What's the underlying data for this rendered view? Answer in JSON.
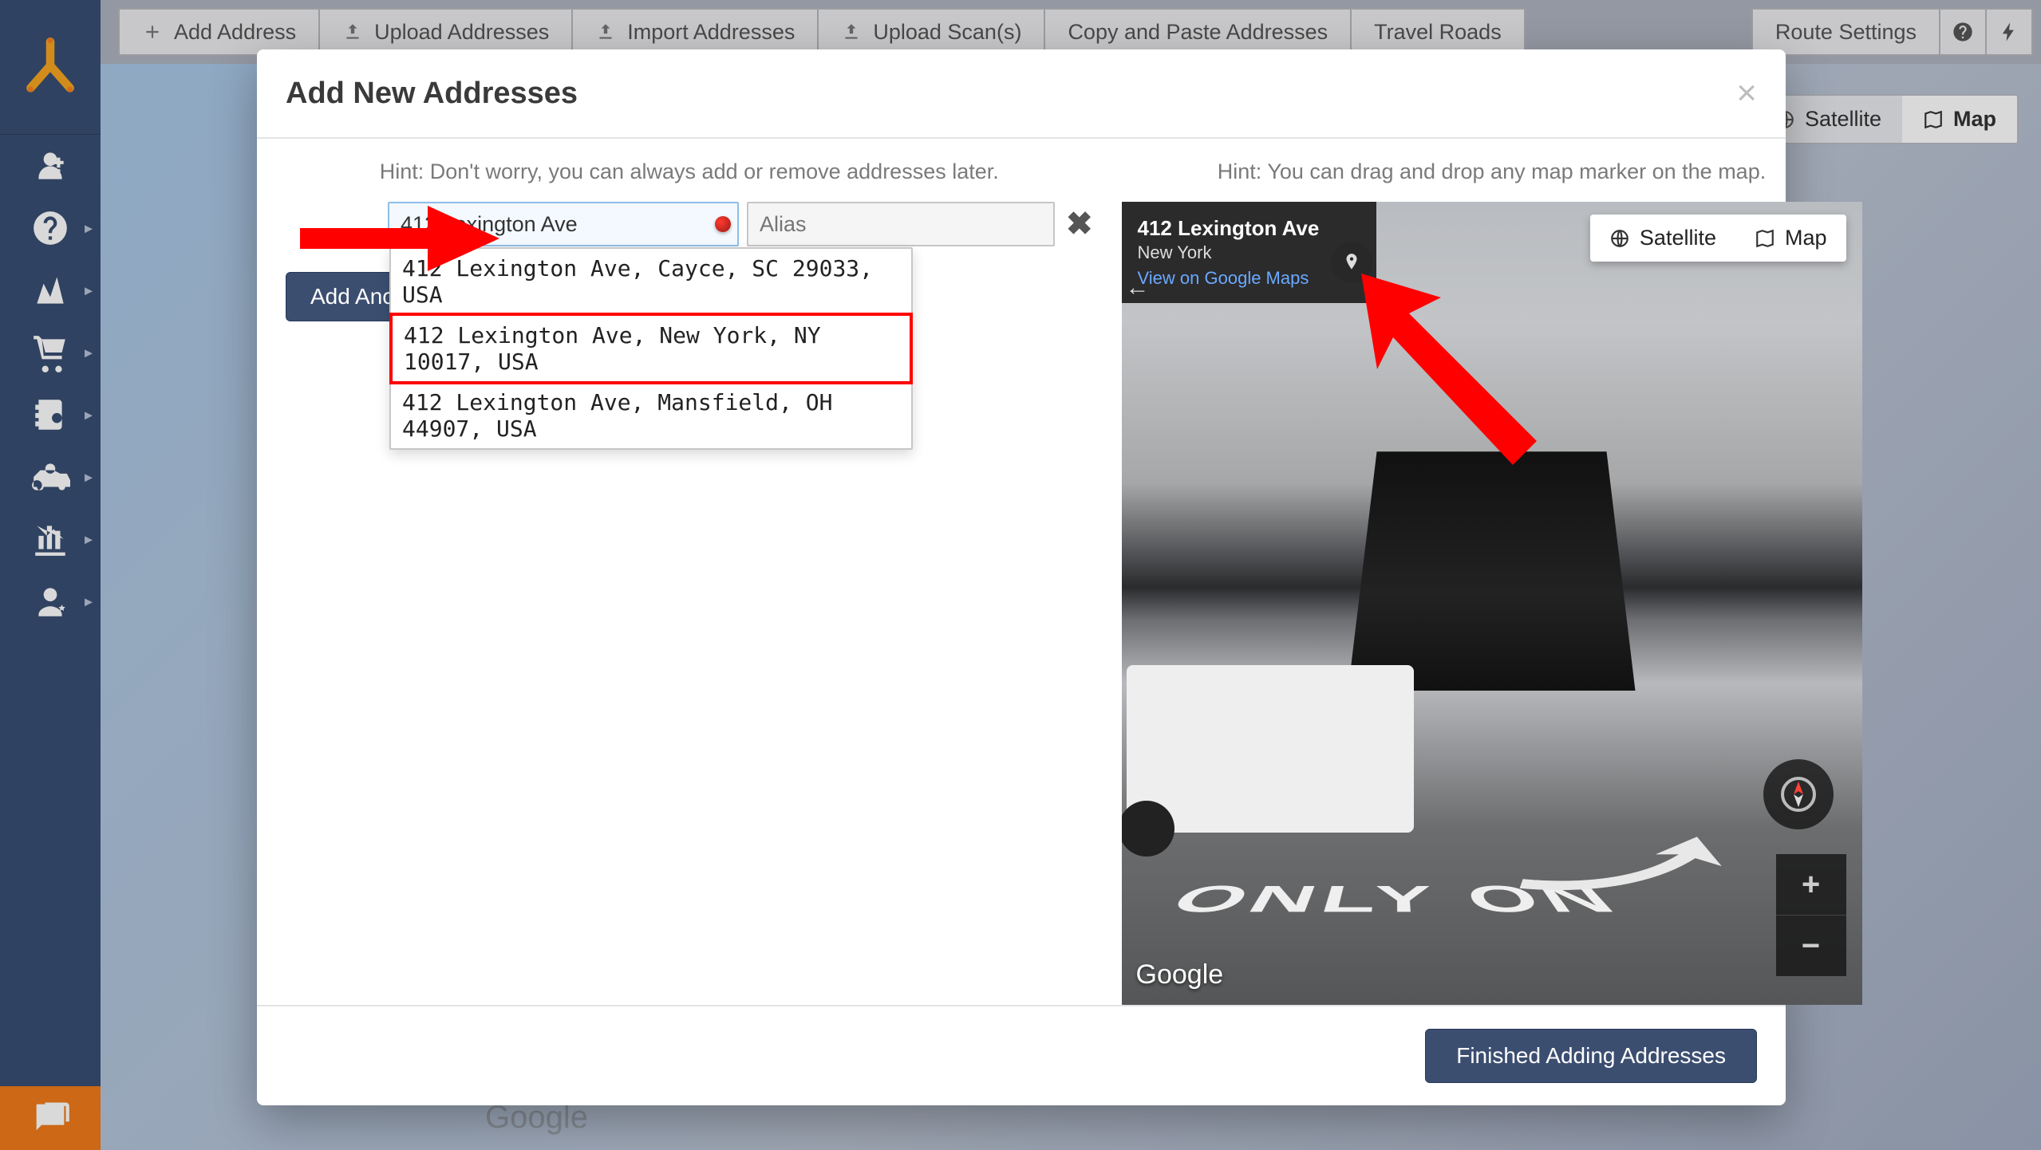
{
  "toolbar": {
    "add_address": "Add Address",
    "upload_addresses": "Upload Addresses",
    "import_addresses": "Import Addresses",
    "upload_scans": "Upload Scan(s)",
    "copy_paste": "Copy and Paste Addresses",
    "travel_roads": "Travel Roads",
    "route_settings": "Route Settings"
  },
  "map_bg": {
    "satellite": "Satellite",
    "map": "Map"
  },
  "modal": {
    "title": "Add New Addresses",
    "hint_left": "Hint: Don't worry, you can always add or remove addresses later.",
    "hint_right": "Hint: You can drag and drop any map marker on the map.",
    "address_value": "412 Lexington Ave",
    "alias_placeholder": "Alias",
    "add_another": "Add Another Address",
    "suggestions": [
      "412 Lexington Ave, Cayce, SC 29033, USA",
      "412 Lexington Ave, New York, NY 10017, USA",
      "412 Lexington Ave, Mansfield, OH 44907, USA"
    ],
    "sv": {
      "title": "412 Lexington Ave",
      "subtitle": "New York",
      "link": "View on Google Maps",
      "satellite": "Satellite",
      "map": "Map",
      "google": "Google",
      "lane_text": "ONLY ON"
    },
    "finish": "Finished Adding Addresses"
  },
  "bg_google": "Google"
}
